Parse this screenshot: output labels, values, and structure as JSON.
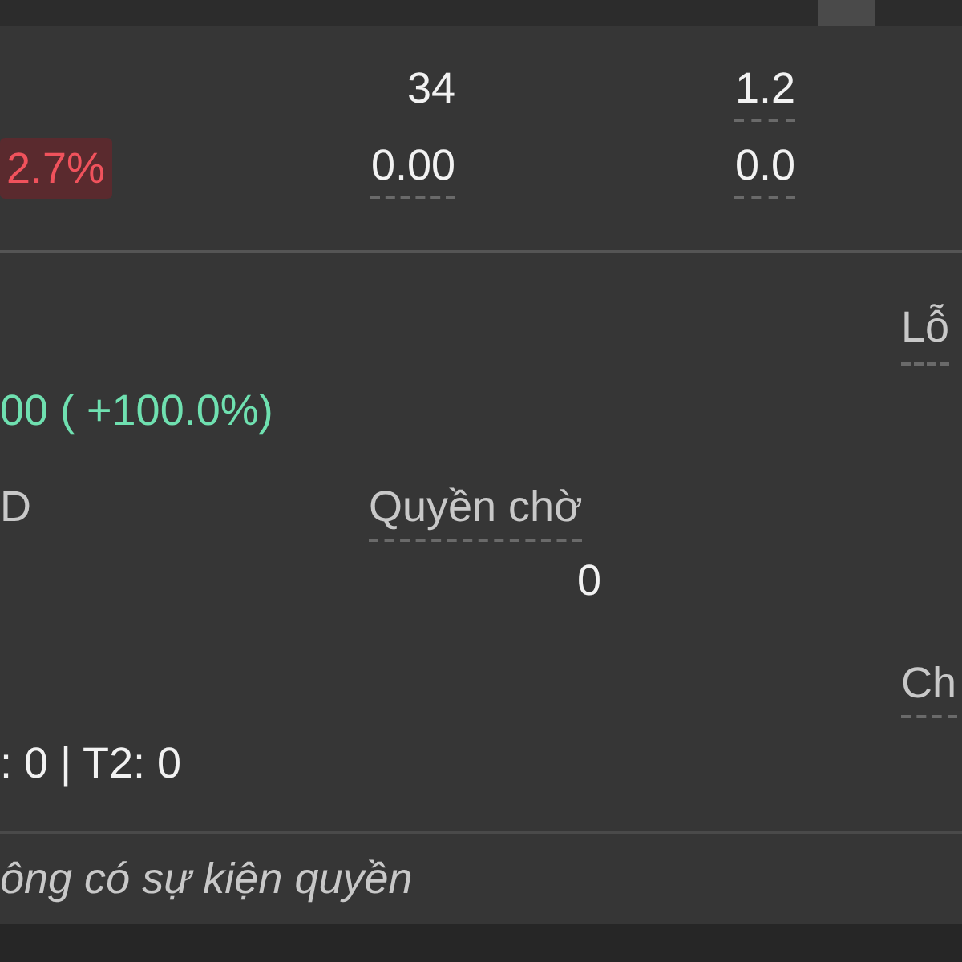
{
  "stats_rows": [
    {
      "cells": [
        {
          "text": "34",
          "underlined": false
        },
        {
          "text": "1.2",
          "underlined": true
        }
      ]
    },
    {
      "badge": "2.7%",
      "cells": [
        {
          "text": "0.00",
          "underlined": true
        },
        {
          "text": "0.0",
          "underlined": true
        }
      ]
    }
  ],
  "summary": {
    "right_label_1": "Lỗ",
    "change": "00 ( +100.0%)",
    "left_label": "D",
    "pending_rights_label": "Quyền chờ",
    "pending_rights_value": "0",
    "right_label_2": "Ch",
    "settlement": ": 0 | T2: 0"
  },
  "rights_events": {
    "message": "ông có sự kiện quyền"
  }
}
